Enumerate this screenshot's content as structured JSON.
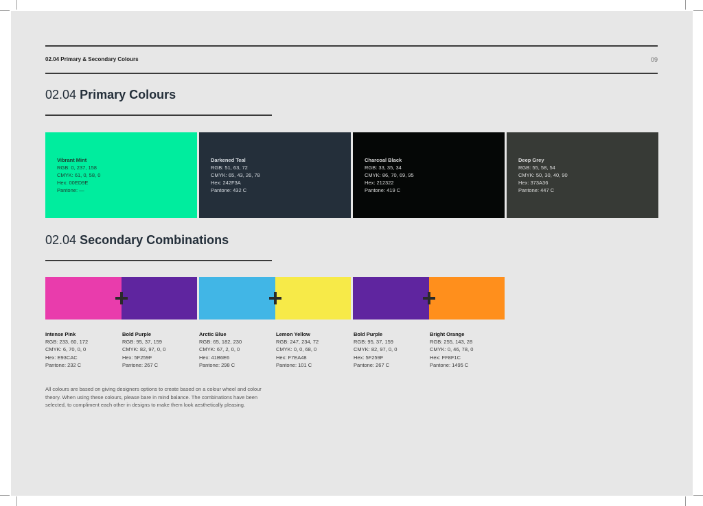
{
  "header": {
    "title": "02.04 Primary & Secondary Colours",
    "page_number": "09"
  },
  "primary": {
    "title_number": "02.04",
    "title_name": "Primary Colours",
    "swatches": [
      {
        "name": "Vibrant Mint",
        "rgb": "RGB: 0, 237, 158",
        "cmyk": "CMYK: 61, 0, 58, 0",
        "hex": "Hex: 00ED9E",
        "pantone": "Pantone: —",
        "color": "#00ED9E",
        "text_color": "#1f3a30"
      },
      {
        "name": "Darkened Teal",
        "rgb": "RGB: 51, 63, 72",
        "cmyk": "CMYK: 65, 43, 26, 78",
        "hex": "Hex: 242F3A",
        "pantone": "Pantone: 432 C",
        "color": "#242F3A",
        "text_color": "#d8dde2"
      },
      {
        "name": "Charcoal Black",
        "rgb": "RGB: 33, 35, 34",
        "cmyk": "CMYK: 86, 70, 69, 95",
        "hex": "Hex: 212322",
        "pantone": "Pantone: 419 C",
        "color": "#050706",
        "text_color": "#d8d8d8"
      },
      {
        "name": "Deep Grey",
        "rgb": "RGB: 55, 58, 54",
        "cmyk": "CMYK: 50, 30, 40, 90",
        "hex": "Hex: 373A36",
        "pantone": "Pantone: 447 C",
        "color": "#373A36",
        "text_color": "#dcdcdc"
      }
    ]
  },
  "secondary": {
    "title_number": "02.04",
    "title_name": "Secondary Combinations",
    "colors": [
      {
        "name": "Intense Pink",
        "rgb": "RGB: 233, 60, 172",
        "cmyk": "CMYK: 6, 70, 0, 0",
        "hex": "Hex: E93CAC",
        "pantone": "Pantone: 232 C",
        "color": "#E93CAC"
      },
      {
        "name": "Bold Purple",
        "rgb": "RGB: 95, 37, 159",
        "cmyk": "CMYK: 82, 97, 0, 0",
        "hex": "Hex: 5F259F",
        "pantone": "Pantone: 267 C",
        "color": "#5F259F"
      },
      {
        "name": "Arctic Blue",
        "rgb": "RGB: 65, 182, 230",
        "cmyk": "CMYK: 67, 2, 0, 0",
        "hex": "Hex: 41B6E6",
        "pantone": "Pantone: 298 C",
        "color": "#41B6E6"
      },
      {
        "name": "Lemon Yellow",
        "rgb": "RGB: 247, 234, 72",
        "cmyk": "CMYK: 0, 0, 68, 0",
        "hex": "Hex: F7EA48",
        "pantone": "Pantone: 101 C",
        "color": "#F7EA48"
      },
      {
        "name": "Bold Purple",
        "rgb": "RGB: 95, 37, 159",
        "cmyk": "CMYK: 82, 97, 0, 0",
        "hex": "Hex: 5F259F",
        "pantone": "Pantone: 267 C",
        "color": "#5F259F"
      },
      {
        "name": "Bright Orange",
        "rgb": "RGB: 255, 143, 28",
        "cmyk": "CMYK: 0, 46, 78, 0",
        "hex": "Hex: FF8F1C",
        "pantone": "Pantone: 1495 C",
        "color": "#FF8F1C"
      }
    ]
  },
  "note": "All colours are based on giving designers options to create based on a colour wheel and colour theory. When using these colours, please bare in mind balance. The combinations have been selected, to compliment each other in designs to make them look aesthetically pleasing."
}
